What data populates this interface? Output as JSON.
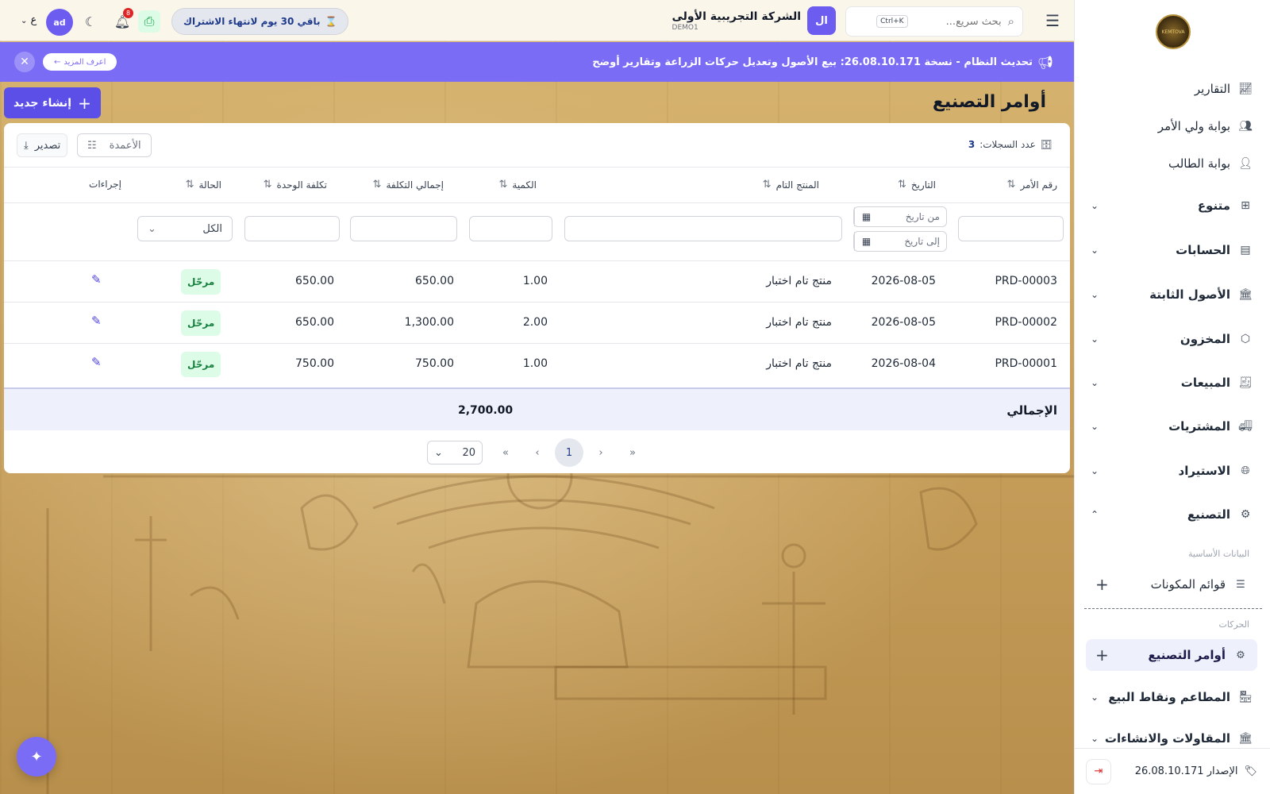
{
  "header": {
    "search_placeholder": "بحث سريع...",
    "search_shortcut": "Ctrl+K",
    "company_avatar": "ال",
    "company_name": "الشركة التجريبية الأولى",
    "company_code": "DEMO1",
    "subscription": "باقي 30 يوم لانتهاء الاشتراك",
    "notifications_count": "8",
    "user_initials": "ad",
    "language": "ع"
  },
  "announcement": {
    "text": "تحديث النظام - نسخة 26.08.10.171: بيع الأصول وتعديل حركات الزراعة وتقارير أوضح",
    "more": "اعرف المزيد"
  },
  "page": {
    "title": "أوامر التصنيع",
    "create": "إنشاء جديد"
  },
  "toolbar": {
    "records_label": "عدد السجلات:",
    "records_count": "3",
    "columns": "الأعمدة",
    "export": "تصدير"
  },
  "table": {
    "headers": {
      "order_no": "رقم الأمر",
      "date": "التاريخ",
      "product": "المنتج التام",
      "qty": "الكمية",
      "total_cost": "إجمالي التكلفة",
      "unit_cost": "تكلفة الوحدة",
      "status": "الحالة",
      "actions": "إجراءات"
    },
    "filters": {
      "from_date": "من تاريخ",
      "to_date": "إلى تاريخ",
      "status_all": "الكل"
    },
    "rows": [
      {
        "order_no": "PRD-00003",
        "date": "2026-08-05",
        "product": "منتج تام اختبار",
        "qty": "1.00",
        "total_cost": "650.00",
        "unit_cost": "650.00",
        "status": "مرحّل"
      },
      {
        "order_no": "PRD-00002",
        "date": "2026-08-05",
        "product": "منتج تام اختبار",
        "qty": "2.00",
        "total_cost": "1,300.00",
        "unit_cost": "650.00",
        "status": "مرحّل"
      },
      {
        "order_no": "PRD-00001",
        "date": "2026-08-04",
        "product": "منتج تام اختبار",
        "qty": "1.00",
        "total_cost": "750.00",
        "unit_cost": "750.00",
        "status": "مرحّل"
      }
    ],
    "total_label": "الإجمالي",
    "total_value": "2,700.00"
  },
  "pagination": {
    "current": "1",
    "page_size": "20"
  },
  "sidebar": {
    "logo_text": "KEMTOVA",
    "links": [
      {
        "label": "التقارير",
        "icon": "chart-icon"
      },
      {
        "label": "بوابة ولي الأمر",
        "icon": "users-icon"
      },
      {
        "label": "بوابة الطالب",
        "icon": "user-icon"
      }
    ],
    "groups": [
      {
        "label": "متنوع",
        "icon": "grid-icon"
      },
      {
        "label": "الحسابات",
        "icon": "ledger-icon"
      },
      {
        "label": "الأصول الثابتة",
        "icon": "building-icon"
      },
      {
        "label": "المخزون",
        "icon": "box-icon"
      },
      {
        "label": "المبيعات",
        "icon": "receipt-icon"
      },
      {
        "label": "المشتريات",
        "icon": "truck-icon"
      },
      {
        "label": "الاستيراد",
        "icon": "globe-icon"
      },
      {
        "label": "التصنيع",
        "icon": "gear-icon"
      }
    ],
    "manufacturing": {
      "master_label": "البيانات الأساسية",
      "bom": "قوائم المكونات",
      "transactions_label": "الحركات",
      "orders": "أوامر التصنيع"
    },
    "more_groups": [
      {
        "label": "المطاعم ونقاط البيع"
      },
      {
        "label": "المقاولات والانشاءات"
      }
    ],
    "version": "الإصدار 26.08.10.171"
  }
}
